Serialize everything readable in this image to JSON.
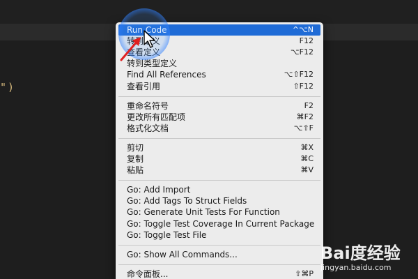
{
  "code": {
    "fragment": "\")"
  },
  "context_menu": {
    "groups": [
      [
        {
          "label": "Run Code",
          "shortcut": "^⌥N",
          "highlighted": true
        },
        {
          "label": "转到定义",
          "shortcut": "F12"
        },
        {
          "label": "查看定义",
          "shortcut": "⌥F12"
        },
        {
          "label": "转到类型定义",
          "shortcut": ""
        },
        {
          "label": "Find All References",
          "shortcut": "⌥⇧F12"
        },
        {
          "label": "查看引用",
          "shortcut": "⇧F12"
        }
      ],
      [
        {
          "label": "重命名符号",
          "shortcut": "F2"
        },
        {
          "label": "更改所有匹配项",
          "shortcut": "⌘F2"
        },
        {
          "label": "格式化文档",
          "shortcut": "⌥⇧F"
        }
      ],
      [
        {
          "label": "剪切",
          "shortcut": "⌘X"
        },
        {
          "label": "复制",
          "shortcut": "⌘C"
        },
        {
          "label": "粘贴",
          "shortcut": "⌘V"
        }
      ],
      [
        {
          "label": "Go: Add Import",
          "shortcut": ""
        },
        {
          "label": "Go: Add Tags To Struct Fields",
          "shortcut": ""
        },
        {
          "label": "Go: Generate Unit Tests For Function",
          "shortcut": ""
        },
        {
          "label": "Go: Toggle Test Coverage In Current Package",
          "shortcut": ""
        },
        {
          "label": "Go: Toggle Test File",
          "shortcut": ""
        }
      ],
      [
        {
          "label": "Go: Show All Commands...",
          "shortcut": ""
        }
      ],
      [
        {
          "label": "命令面板...",
          "shortcut": "⇧⌘P"
        }
      ]
    ]
  },
  "watermark": {
    "brand": "Bai度经验",
    "url": "jingyan.baidu.com"
  },
  "colors": {
    "editor_background": "#1e1e1e",
    "menu_background": "#ececec",
    "menu_highlight": "#1f6bd6",
    "annotation_arrow": "#e02020"
  }
}
